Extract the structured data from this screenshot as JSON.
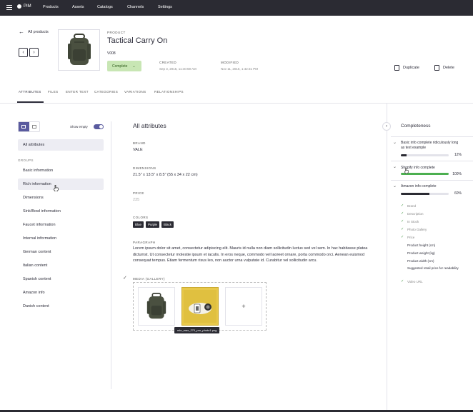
{
  "topbar": {
    "brand": "PIM",
    "nav": [
      "Products",
      "Assets",
      "Catalogs",
      "Channels",
      "Settings"
    ]
  },
  "header": {
    "back_label": "All products",
    "product_label": "PRODUCT",
    "product_title": "Tactical Carry On",
    "sku": "V008",
    "status": "Complete",
    "created_label": "CREATED",
    "created_value": "Sep 3, 2016, 11:40:59 AM",
    "modified_label": "MODIFIED",
    "modified_value": "Nov 11, 2016, 1:42:31 PM",
    "duplicate_label": "Duplicate",
    "delete_label": "Delete"
  },
  "tabs": [
    "ATTRIBUTES",
    "FILES",
    "ENTER TEXT",
    "CATEGORIES",
    "VARIATIONS",
    "RELATIONSHIPS"
  ],
  "sidebar": {
    "show_empty_label": "Show empty",
    "all_attributes": "All attributes",
    "groups_label": "GROUPS",
    "groups": [
      "Basic information",
      "Rich information",
      "Dimensions",
      "Sink/Bowl information",
      "Faucet information",
      "Internal information",
      "German content",
      "Italian content",
      "Spanish content",
      "Amazon info",
      "Danish content"
    ]
  },
  "main": {
    "title": "All attributes",
    "brand_label": "BRAND",
    "brand_value": "VALE",
    "dimensions_label": "DIMENSIONS",
    "dimensions_value": "21.5\" x 13.5\" x 8.5\" (55 x 34 x 22 cm)",
    "price_label": "PRICE",
    "price_value": "235",
    "colors_label": "COLORS",
    "colors": [
      "Blue",
      "Purple",
      "Black"
    ],
    "paragraph_label": "PARAGRAPH",
    "paragraph_text": "Lorem ipsum dolor sit amet, consectetur adipiscing elit. Mauris id nulla non diam sollicitudin luctus sed vel sem. In hac habitasse platea dictumst. Ut consectetur molestie ipsum et iaculis. In eros neque, commodo vel laoreet ornare, porta commodo orci. Aenean euismod consequat tempus. Etiam fermentum risus leo, non auctor urna vulputate id. Curabitur vel sollicitudin arcu.",
    "media_label": "MEDIA (GALLERY)",
    "media_tooltip": "mle_max_270_pro_photo1.png",
    "add_symbol": "+"
  },
  "completeness": {
    "title": "Completeness",
    "items": [
      {
        "name": "Basic info complete ridiculously long as text example",
        "percent": "12%",
        "fill": 0.12,
        "color": "#2b2b33"
      },
      {
        "name": "Shopify info complete",
        "percent": "100%",
        "fill": 1.0,
        "color": "#4caf50"
      },
      {
        "name": "Amazon info complete",
        "percent": "60%",
        "fill": 0.6,
        "color": "#2b2b33"
      }
    ],
    "amazon_attrs": [
      {
        "label": "Brand",
        "done": true
      },
      {
        "label": "Description",
        "done": true
      },
      {
        "label": "In Stock",
        "done": true
      },
      {
        "label": "Photo Gallery",
        "done": true
      },
      {
        "label": "Price",
        "done": true
      },
      {
        "label": "Product height (cm)",
        "done": false
      },
      {
        "label": "Product weight (kg)",
        "done": false
      },
      {
        "label": "Product width (cm)",
        "done": false
      },
      {
        "label": "Suggested retail price for readability",
        "done": false
      },
      {
        "label": "Video URL",
        "done": true
      }
    ]
  },
  "colors": {
    "nav_bg": "#2b2b33",
    "accent": "#5a5b9f",
    "complete_bg": "#c8e6b4",
    "progress_green": "#4caf50"
  }
}
